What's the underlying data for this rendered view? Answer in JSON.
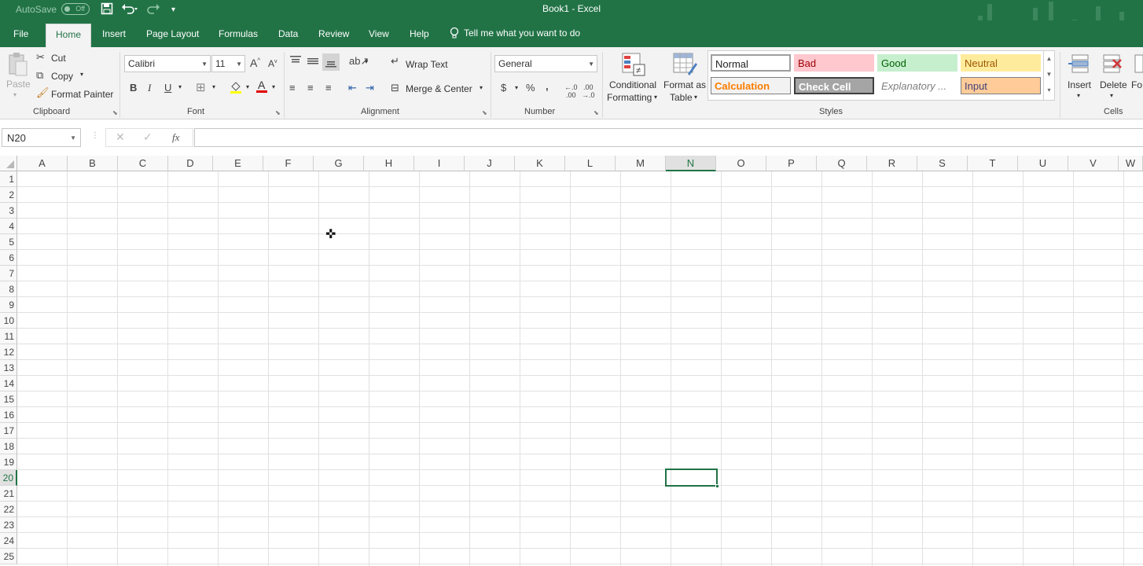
{
  "titlebar": {
    "autosave_label": "AutoSave",
    "autosave_state": "Off",
    "title": "Book1  -  Excel"
  },
  "tabs": [
    "File",
    "Home",
    "Insert",
    "Page Layout",
    "Formulas",
    "Data",
    "Review",
    "View",
    "Help"
  ],
  "tell_me": "Tell me what you want to do",
  "clipboard": {
    "paste": "Paste",
    "cut": "Cut",
    "copy": "Copy",
    "format_painter": "Format Painter",
    "group_label": "Clipboard"
  },
  "font": {
    "family": "Calibri",
    "size": "11",
    "group_label": "Font",
    "bold": "B",
    "italic": "I",
    "underline": "U"
  },
  "alignment": {
    "wrap_text": "Wrap Text",
    "merge_center": "Merge & Center",
    "group_label": "Alignment"
  },
  "number": {
    "format": "General",
    "currency": "$",
    "percent": "%",
    "comma": ",",
    "group_label": "Number"
  },
  "styles": {
    "conditional_formatting_1": "Conditional",
    "conditional_formatting_2": "Formatting",
    "format_as_table_1": "Format as",
    "format_as_table_2": "Table",
    "group_label": "Styles",
    "gallery": [
      {
        "label": "Normal",
        "color": "#000000",
        "bg": "#ffffff",
        "border": "#9e9e9e"
      },
      {
        "label": "Bad",
        "color": "#9c0006",
        "bg": "#ffc7ce",
        "border": "#ffc7ce"
      },
      {
        "label": "Good",
        "color": "#006100",
        "bg": "#c6efce",
        "border": "#c6efce"
      },
      {
        "label": "Neutral",
        "color": "#9c5700",
        "bg": "#ffeb9c",
        "border": "#ffeb9c"
      },
      {
        "label": "Calculation",
        "color": "#fa7d00",
        "bg": "#f2f2f2",
        "border": "#7f7f7f"
      },
      {
        "label": "Check Cell",
        "color": "#ffffff",
        "bg": "#a5a5a5",
        "border": "#3f3f3f"
      },
      {
        "label": "Explanatory ...",
        "color": "#7f7f7f",
        "bg": "#ffffff",
        "border": "#ffffff"
      },
      {
        "label": "Input",
        "color": "#3f3f76",
        "bg": "#ffcc99",
        "border": "#7f7f7f"
      }
    ]
  },
  "cells_group": {
    "insert": "Insert",
    "delete": "Delete",
    "format": "Fo",
    "group_label": "Cells"
  },
  "formula_bar": {
    "name_box": "N20",
    "fx": "fx",
    "content": ""
  },
  "grid": {
    "columns": [
      "A",
      "B",
      "C",
      "D",
      "E",
      "F",
      "G",
      "H",
      "I",
      "J",
      "K",
      "L",
      "M",
      "N",
      "O",
      "P",
      "Q",
      "R",
      "S",
      "T",
      "U",
      "V",
      "W"
    ],
    "rows": [
      "1",
      "2",
      "3",
      "4",
      "5",
      "6",
      "7",
      "8",
      "9",
      "10",
      "11",
      "12",
      "13",
      "14",
      "15",
      "16",
      "17",
      "18",
      "19",
      "20",
      "21",
      "22",
      "23",
      "24",
      "25"
    ],
    "selected_column": "N",
    "selected_row": "20"
  },
  "colors": {
    "brand": "#217346",
    "ribbon_bg": "#f3f3f3"
  }
}
